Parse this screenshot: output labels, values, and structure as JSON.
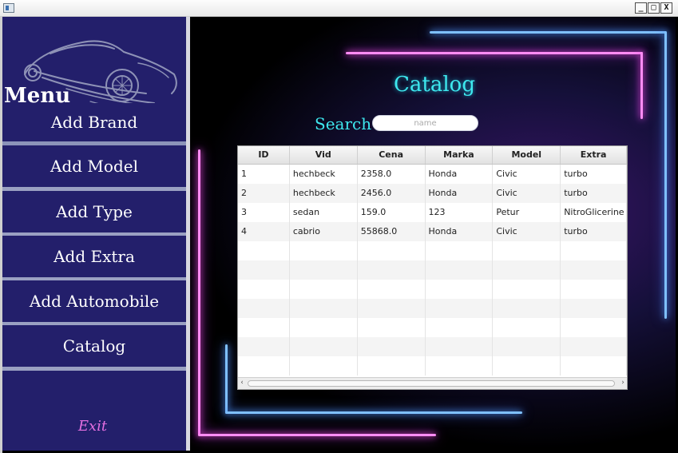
{
  "window": {
    "minimize": "_",
    "maximize": "□",
    "close": "X"
  },
  "sidebar": {
    "menu_title": "Menu",
    "items": [
      {
        "label": "Add Brand"
      },
      {
        "label": "Add Model"
      },
      {
        "label": "Add Type"
      },
      {
        "label": "Add Extra"
      },
      {
        "label": "Add Automobile"
      },
      {
        "label": "Catalog"
      }
    ],
    "exit_label": "Exit",
    "logo_icon": "car-logo-icon"
  },
  "main": {
    "title": "Catalog",
    "search_label": "Search",
    "search_placeholder": "name",
    "search_value": ""
  },
  "table": {
    "columns": [
      "ID",
      "Vid",
      "Cena",
      "Marka",
      "Model",
      "Extra"
    ],
    "rows": [
      [
        "1",
        "hechbeck",
        "2358.0",
        "Honda",
        "Civic",
        "turbo"
      ],
      [
        "2",
        "hechbeck",
        "2456.0",
        "Honda",
        "Civic",
        "turbo"
      ],
      [
        "3",
        "sedan",
        "159.0",
        "123",
        "Petur",
        "NitroGlicerine"
      ],
      [
        "4",
        "cabrio",
        "55868.0",
        "Honda",
        "Civic",
        "turbo"
      ]
    ]
  },
  "colors": {
    "sidebar_bg": "#231f6b",
    "title_cyan": "#3ee8ee",
    "exit_pink": "#e36ee0",
    "neon_pink": "#ff5cf0",
    "neon_blue": "#4fa0ff"
  }
}
